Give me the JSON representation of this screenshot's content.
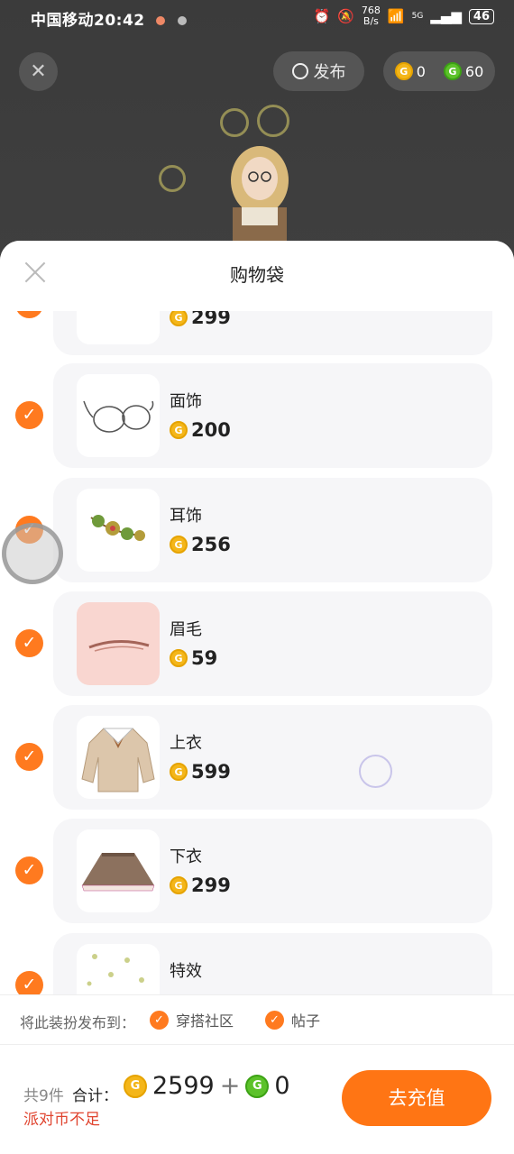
{
  "status_bar": {
    "carrier_time": "中国移动20:42",
    "net_speed_value": "768",
    "net_speed_unit": "B/s",
    "signal": "5G",
    "battery": "46"
  },
  "top": {
    "publish_label": "发布",
    "gold_balance": "0",
    "green_balance": "60"
  },
  "sheet": {
    "title": "购物袋"
  },
  "items": [
    {
      "name": "",
      "price": "299"
    },
    {
      "name": "面饰",
      "price": "200"
    },
    {
      "name": "耳饰",
      "price": "256"
    },
    {
      "name": "眉毛",
      "price": "59"
    },
    {
      "name": "上衣",
      "price": "599"
    },
    {
      "name": "下衣",
      "price": "299"
    },
    {
      "name": "特效",
      "price": ""
    }
  ],
  "publish": {
    "label": "将此装扮发布到：",
    "option1": "穿搭社区",
    "option2": "帖子"
  },
  "footer": {
    "count": "共9件",
    "total_label": "合计：",
    "gold_total": "2599",
    "plus": "+",
    "green_total": "0",
    "insufficient": "派对币不足",
    "recharge": "去充值"
  },
  "icons": {
    "gold_coin": "G",
    "green_coin": "G",
    "check": "✓"
  },
  "colors": {
    "accent": "#ff7514",
    "warning": "#e0442f"
  }
}
